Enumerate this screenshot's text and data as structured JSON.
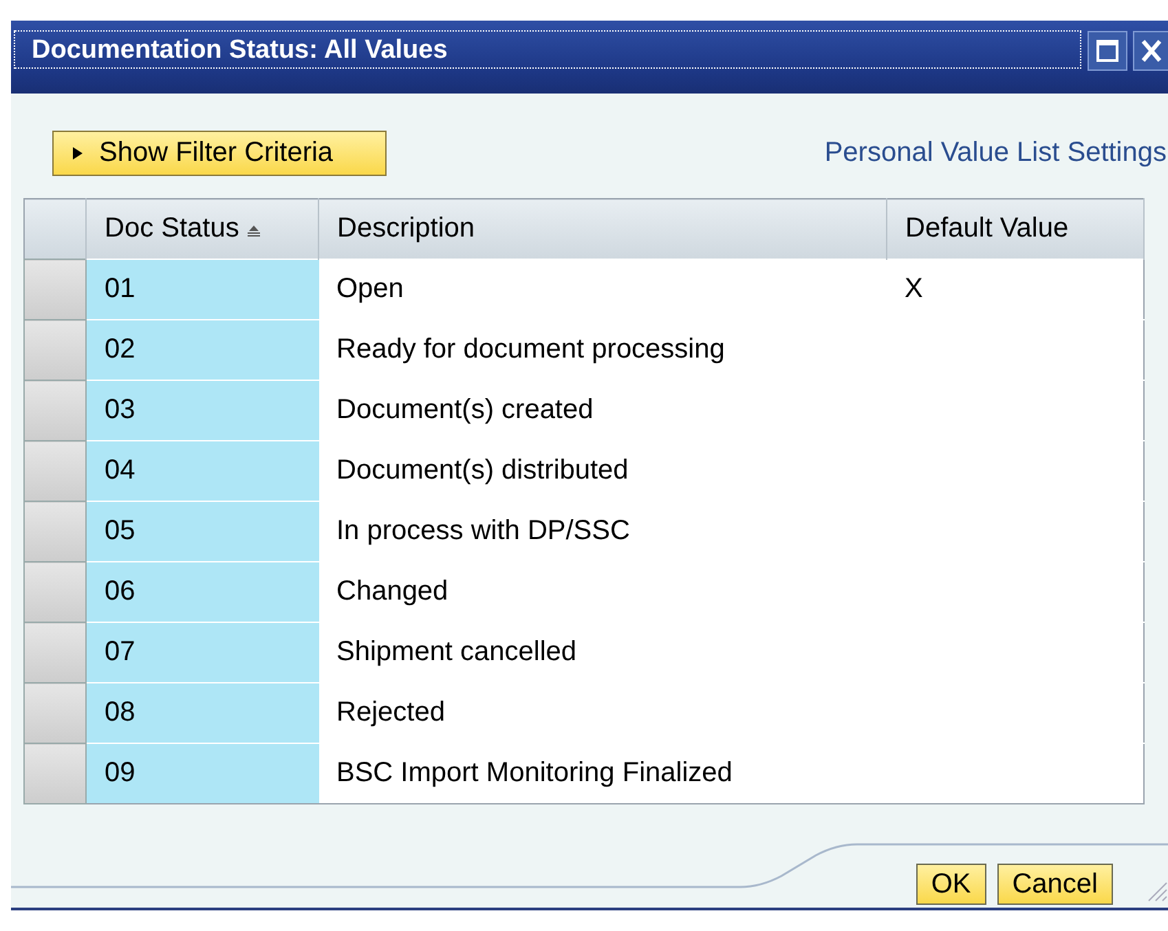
{
  "window": {
    "title": "Documentation Status: All Values"
  },
  "filter_button": {
    "label": "Show Filter Criteria",
    "expanded": false
  },
  "settings_link": "Personal Value List Settings",
  "table": {
    "columns": [
      {
        "label": "Doc Status",
        "sorted": true
      },
      {
        "label": "Description",
        "sorted": false
      },
      {
        "label": "Default Value",
        "sorted": false
      }
    ],
    "rows": [
      {
        "status": "01",
        "description": "Open",
        "default_value": "X"
      },
      {
        "status": "02",
        "description": "Ready for document processing"
      },
      {
        "status": "03",
        "description": "Document(s) created"
      },
      {
        "status": "04",
        "description": "Document(s) distributed"
      },
      {
        "status": "05",
        "description": "In process with DP/SSC"
      },
      {
        "status": "06",
        "description": "Changed"
      },
      {
        "status": "07",
        "description": "Shipment cancelled"
      },
      {
        "status": "08",
        "description": "Rejected"
      },
      {
        "status": "09",
        "description": "BSC Import Monitoring Finalized"
      }
    ]
  },
  "buttons": [
    "OK",
    "Cancel"
  ]
}
